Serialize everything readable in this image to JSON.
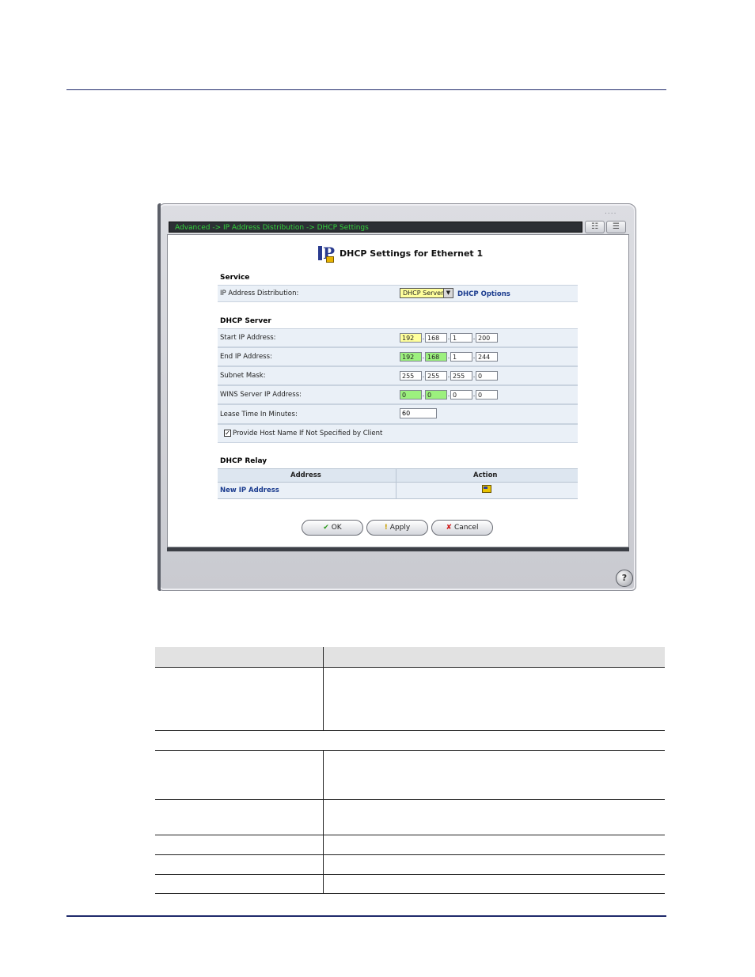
{
  "window": {
    "breadcrumb": "Advanced -> IP Address Distribution -> DHCP Settings",
    "page_title": "DHCP Settings for Ethernet 1",
    "grip": "....",
    "help_label": "?"
  },
  "service": {
    "title": "Service",
    "ip_distribution_label": "IP Address Distribution:",
    "ip_distribution_value": "DHCP Server",
    "dhcp_options_link": "DHCP Options"
  },
  "dhcp_server": {
    "title": "DHCP Server",
    "start_ip": {
      "label": "Start IP Address:",
      "octets": [
        "192",
        "168",
        "1",
        "200"
      ]
    },
    "end_ip": {
      "label": "End IP Address:",
      "octets": [
        "192",
        "168",
        "1",
        "244"
      ]
    },
    "subnet_mask": {
      "label": "Subnet Mask:",
      "octets": [
        "255",
        "255",
        "255",
        "0"
      ]
    },
    "wins_ip": {
      "label": "WINS Server IP Address:",
      "octets": [
        "0",
        "0",
        "0",
        "0"
      ]
    },
    "lease_time": {
      "label": "Lease Time In Minutes:",
      "value": "60"
    },
    "provide_host_name": {
      "label": "Provide Host Name If Not Specified by Client",
      "checked": true
    }
  },
  "dhcp_relay": {
    "title": "DHCP Relay",
    "columns": [
      "Address",
      "Action"
    ],
    "new_ip_link": "New IP Address"
  },
  "buttons": {
    "ok": "OK",
    "apply": "Apply",
    "cancel": "Cancel"
  },
  "icons": {
    "ok": "checkmark-icon",
    "apply": "exclamation-icon",
    "cancel": "x-icon",
    "network": "network-icon",
    "list": "list-icon",
    "help": "help-icon",
    "new": "new-entry-icon"
  },
  "colors": {
    "breadcrumb_text": "#33d43b",
    "octet_yellow": "#ffff9c",
    "octet_green": "#9cf07e",
    "row_bg": "#eaf0f7",
    "rule": "#1f2a6b"
  }
}
